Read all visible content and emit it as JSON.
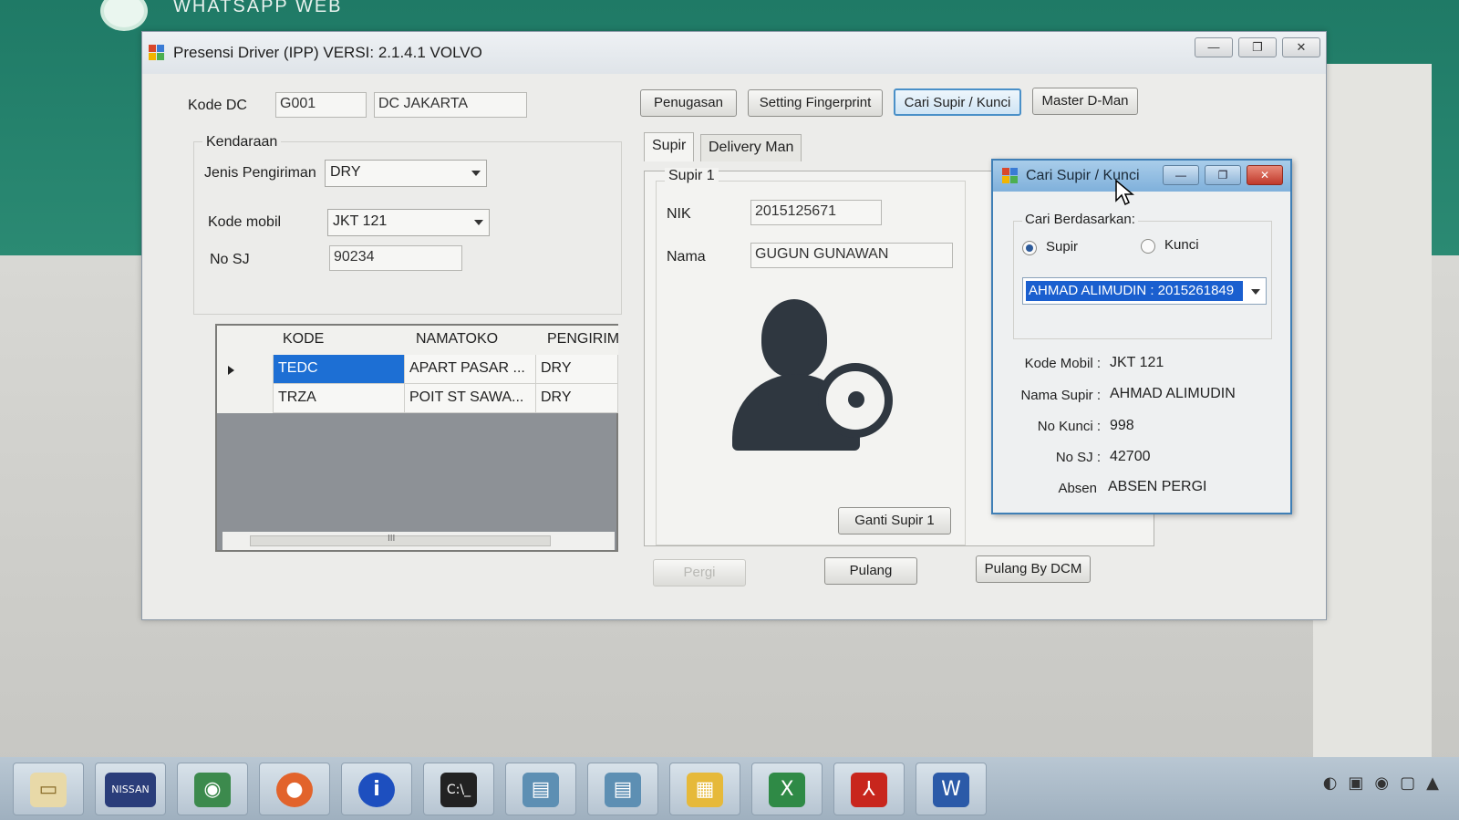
{
  "background": {
    "whatsapp_title": "WHATSAPP WEB"
  },
  "window": {
    "title": "Presensi Driver (IPP) VERSI: 2.1.4.1 VOLVO",
    "controls": {
      "minimize": "—",
      "maximize": "❐",
      "close": "✕"
    }
  },
  "form": {
    "kode_dc_label": "Kode DC",
    "kode_dc_value": "G001",
    "dc_name_value": "DC JAKARTA",
    "kendaraan_label": "Kendaraan",
    "jenis_pengiriman_label": "Jenis Pengiriman",
    "jenis_pengiriman_value": "DRY",
    "kode_mobil_label": "Kode mobil",
    "kode_mobil_value": "JKT 121",
    "no_sj_label": "No SJ",
    "no_sj_value": "90234"
  },
  "toolbar": {
    "penugasan": "Penugasan",
    "setting_fingerprint": "Setting Fingerprint",
    "cari_supir_kunci": "Cari Supir / Kunci",
    "master_dman": "Master D-Man"
  },
  "grid": {
    "columns": [
      "KODE",
      "NAMATOKO",
      "PENGIRIM"
    ],
    "rows": [
      {
        "kode": "TEDC",
        "namatoko": "APART PASAR ...",
        "pengirim": "DRY"
      },
      {
        "kode": "TRZA",
        "namatoko": "POIT ST SAWA...",
        "pengirim": "DRY"
      }
    ],
    "scroll_grip": "III"
  },
  "tabs": [
    {
      "label": "Supir"
    },
    {
      "label": "Delivery Man"
    }
  ],
  "supir_panel": {
    "group_label": "Supir 1",
    "nik_label": "NIK",
    "nik_value": "2015125671",
    "nama_label": "Nama",
    "nama_value": "GUGUN GUNAWAN",
    "ganti_button": "Ganti Supir 1"
  },
  "actions": {
    "pergi": "Pergi",
    "pulang": "Pulang",
    "pulang_dcm": "Pulang By DCM"
  },
  "dialog": {
    "title": "Cari Supir / Kunci",
    "group_label": "Cari Berdasarkan:",
    "radio_supir": "Supir",
    "radio_kunci": "Kunci",
    "selected_value": "AHMAD ALIMUDIN : 2015261849",
    "fields": [
      {
        "label": "Kode Mobil :",
        "value": "JKT 121"
      },
      {
        "label": "Nama Supir :",
        "value": "AHMAD ALIMUDIN"
      },
      {
        "label": "No Kunci :",
        "value": "998"
      },
      {
        "label": "No SJ :",
        "value": "42700"
      },
      {
        "label": "Absen",
        "value": "ABSEN PERGI"
      }
    ]
  },
  "taskbar": {
    "items": [
      "explorer-icon",
      "nissan-icon",
      "eye-icon",
      "firefox-icon",
      "info-icon",
      "terminal-icon",
      "window-icon",
      "window-icon",
      "control-panel-icon",
      "excel-icon",
      "pdf-icon",
      "word-icon"
    ],
    "nissan_label": "NISSAN"
  }
}
